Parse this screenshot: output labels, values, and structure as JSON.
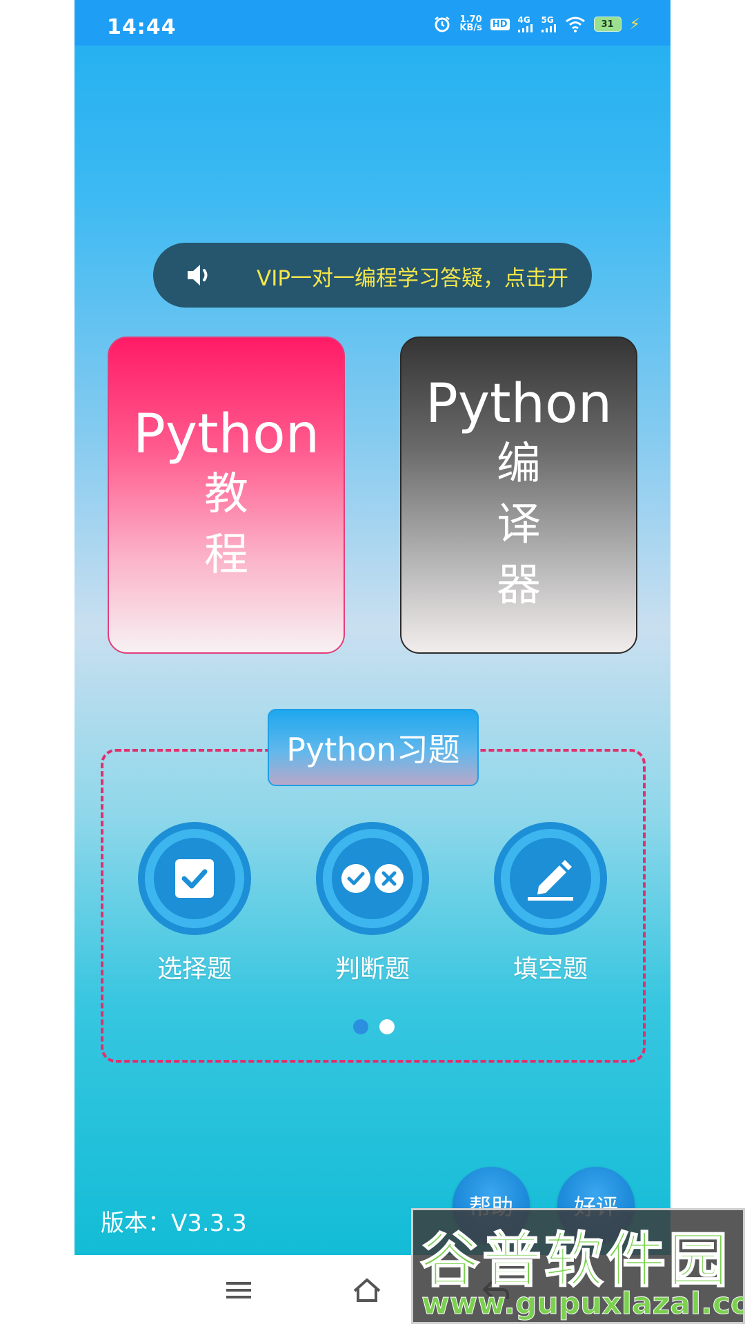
{
  "status_bar": {
    "time": "14:44",
    "net_speed_value": "1.70",
    "net_speed_unit": "KB/s",
    "hd_label": "HD",
    "sim1_label": "4G",
    "sim2_label": "5G",
    "battery": "31",
    "icons": [
      "alarm-icon",
      "hd-icon",
      "signal-4g-icon",
      "signal-5g-icon",
      "wifi-icon",
      "battery-icon",
      "charging-icon"
    ]
  },
  "notice": {
    "text": "VIP一对一编程学习答疑，点击开",
    "icon": "speaker-icon"
  },
  "cards": {
    "tutorial": {
      "title": "Python",
      "chars": [
        "教",
        "程"
      ]
    },
    "compiler": {
      "title": "Python",
      "chars": [
        "编",
        "译",
        "器"
      ]
    }
  },
  "exercises": {
    "title": "Python习题",
    "items": [
      {
        "label": "选择题",
        "icon": "checkbox-icon"
      },
      {
        "label": "判断题",
        "icon": "true-false-icon"
      },
      {
        "label": "填空题",
        "icon": "pen-icon"
      }
    ],
    "pager": {
      "count": 2,
      "active": 0
    }
  },
  "footer": {
    "version": "版本：V3.3.3",
    "help_label": "帮助",
    "rate_label": "好评"
  },
  "navbar": {
    "icons": [
      "menu-icon",
      "home-icon",
      "back-icon"
    ]
  },
  "watermark": {
    "brand": "谷普软件园",
    "url": "www.gupuxlazal.com"
  },
  "colors": {
    "status_bar": "#1e9ff5",
    "notice_bg": "#26566e",
    "notice_text": "#f5e64a",
    "tutorial_card": "#ff1b66",
    "compiler_card": "#353535",
    "panel_border": "#e0306e",
    "icon_blue": "#1c8fd6",
    "watermark_green": "#7bd14f"
  }
}
